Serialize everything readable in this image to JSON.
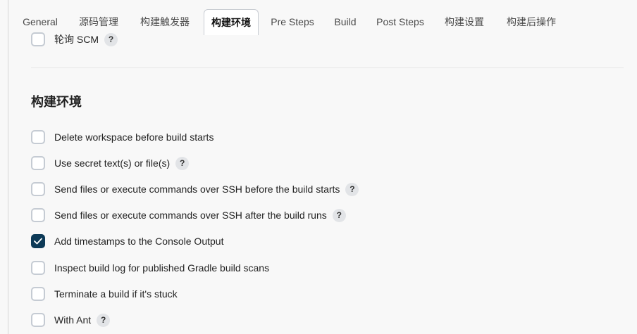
{
  "tabs": [
    {
      "label": "General",
      "active": false
    },
    {
      "label": "源码管理",
      "active": false
    },
    {
      "label": "构建触发器",
      "active": false
    },
    {
      "label": "构建环境",
      "active": true
    },
    {
      "label": "Pre Steps",
      "active": false
    },
    {
      "label": "Build",
      "active": false
    },
    {
      "label": "Post Steps",
      "active": false
    },
    {
      "label": "构建设置",
      "active": false
    },
    {
      "label": "构建后操作",
      "active": false
    }
  ],
  "previous": {
    "poll_scm": {
      "label": "轮询 SCM",
      "checked": false,
      "help": "?"
    }
  },
  "section": {
    "title": "构建环境",
    "options": [
      {
        "label": "Delete workspace before build starts",
        "checked": false,
        "help": null
      },
      {
        "label": "Use secret text(s) or file(s)",
        "checked": false,
        "help": "?"
      },
      {
        "label": "Send files or execute commands over SSH before the build starts",
        "checked": false,
        "help": "?"
      },
      {
        "label": "Send files or execute commands over SSH after the build runs",
        "checked": false,
        "help": "?"
      },
      {
        "label": "Add timestamps to the Console Output",
        "checked": true,
        "help": null
      },
      {
        "label": "Inspect build log for published Gradle build scans",
        "checked": false,
        "help": null
      },
      {
        "label": "Terminate a build if it's stuck",
        "checked": false,
        "help": null
      },
      {
        "label": "With Ant",
        "checked": false,
        "help": "?"
      }
    ]
  },
  "colors": {
    "checked_fill": "#0d3a57",
    "checkbox_border": "#c5cbd3",
    "help_bg": "#e2e4e7"
  }
}
